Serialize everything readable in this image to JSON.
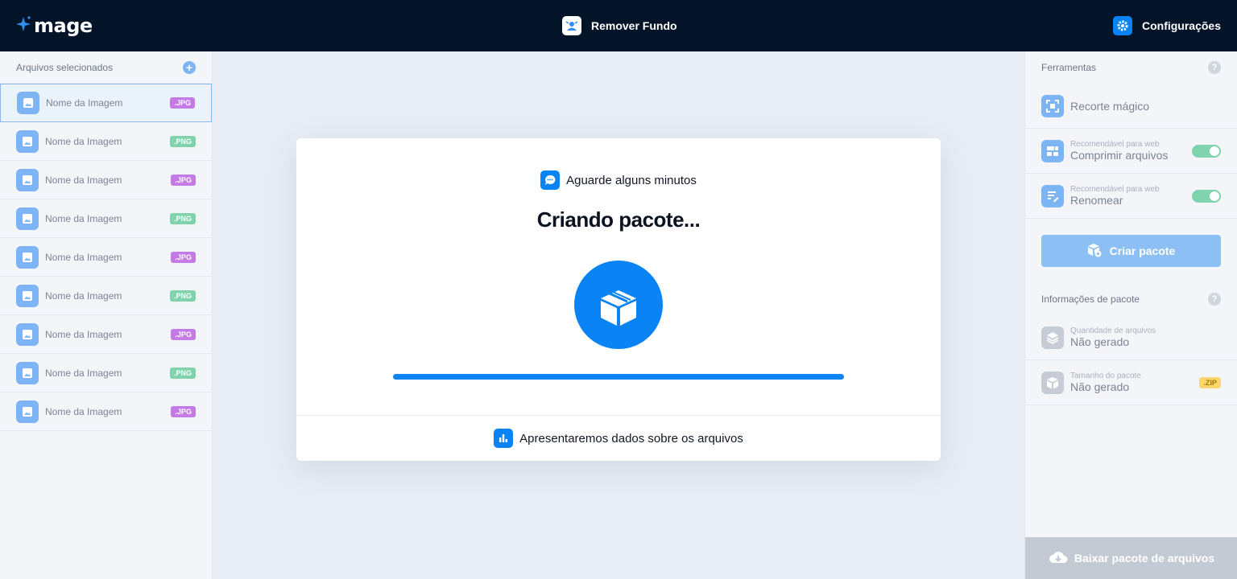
{
  "app": {
    "name": "mage"
  },
  "header": {
    "title": "Remover Fundo",
    "settings_label": "Configurações"
  },
  "left_panel": {
    "title": "Arquivos selecionados",
    "files": [
      {
        "name": "Nome da Imagem",
        "ext": ".JPG"
      },
      {
        "name": "Nome da Imagem",
        "ext": ".PNG"
      },
      {
        "name": "Nome da Imagem",
        "ext": ".JPG"
      },
      {
        "name": "Nome da Imagem",
        "ext": ".PNG"
      },
      {
        "name": "Nome da Imagem",
        "ext": ".JPG"
      },
      {
        "name": "Nome da Imagem",
        "ext": ".PNG"
      },
      {
        "name": "Nome da Imagem",
        "ext": ".JPG"
      },
      {
        "name": "Nome da Imagem",
        "ext": ".PNG"
      },
      {
        "name": "Nome da Imagem",
        "ext": ".JPG"
      }
    ]
  },
  "modal": {
    "wait_text": "Aguarde alguns minutos",
    "heading": "Criando pacote...",
    "progress": 1.0,
    "footer_text": "Apresentaremos dados sobre os arquivos"
  },
  "right_panel": {
    "tools_title": "Ferramentas",
    "tools": [
      {
        "main": "Recorte mágico"
      },
      {
        "sub": "Recomendável para web",
        "main": "Comprimir arquivos",
        "enabled": true
      },
      {
        "sub": "Recomendável para web",
        "main": "Renomear",
        "enabled": true
      }
    ],
    "create_label": "Criar pacote",
    "info_title": "Informações de pacote",
    "info": [
      {
        "sub": "Quantidade de arquivos",
        "main": "Não gerado"
      },
      {
        "sub": "Tamanho do pacote",
        "main": "Não gerado",
        "badge": ".ZIP"
      }
    ],
    "download_label": "Baixar pacote de arquivos"
  },
  "colors": {
    "accent": "#0a84f4",
    "topbar": "#031429",
    "jpg_badge": "#c47be6",
    "png_badge": "#7fd3ad",
    "zip_badge": "#ffd66b"
  }
}
